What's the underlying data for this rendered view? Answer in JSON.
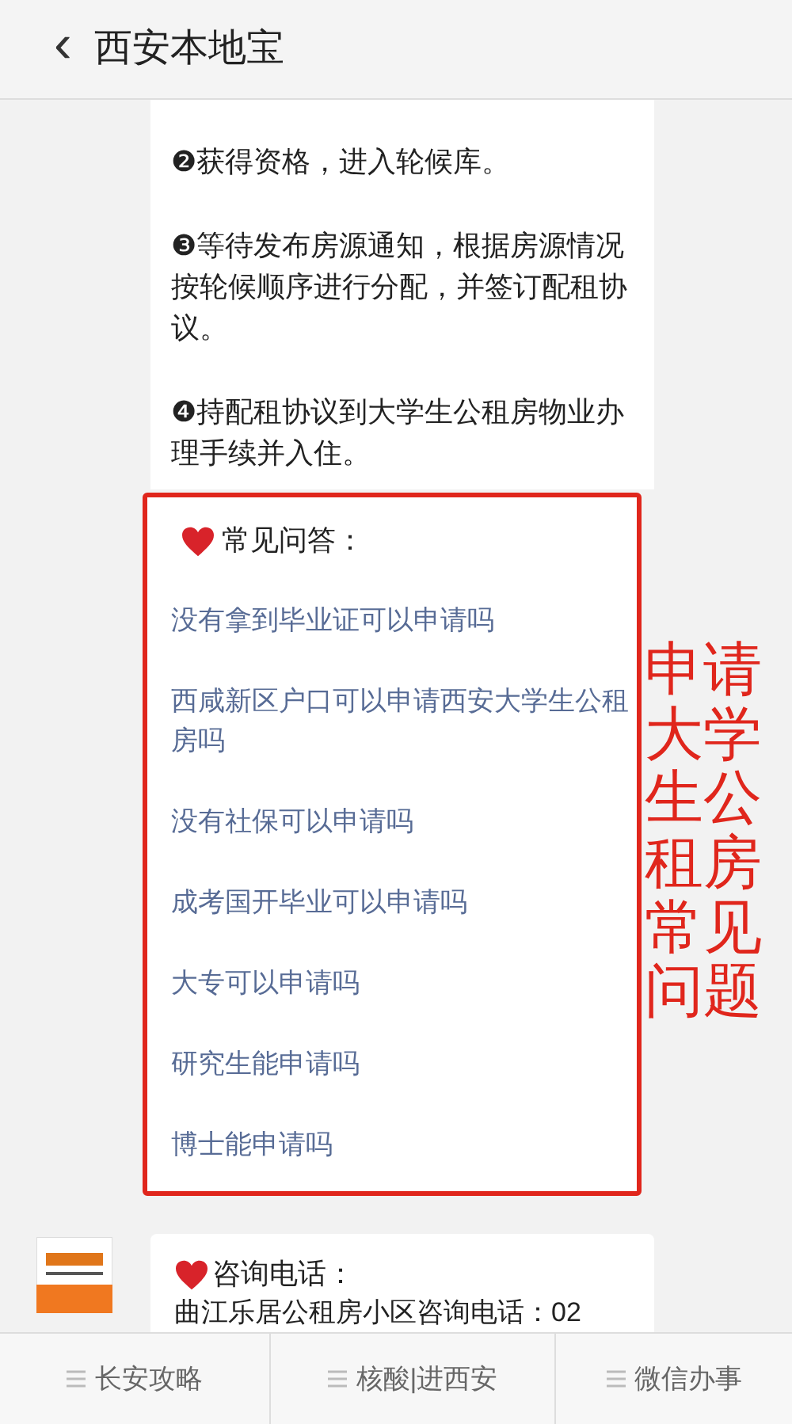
{
  "header": {
    "back": "‹",
    "title": "西安本地宝"
  },
  "steps": [
    "❷获得资格，进入轮候库。",
    "❸等待发布房源通知，根据房源情况按轮候顺序进行分配，并签订配租协议。",
    "❹持配租协议到大学生公租房物业办理手续并入住。"
  ],
  "faq": {
    "heading": "常见问答：",
    "links": [
      "没有拿到毕业证可以申请吗",
      "西咸新区户口可以申请西安大学生公租房吗",
      "没有社保可以申请吗",
      "成考国开毕业可以申请吗",
      "大专可以申请吗",
      "研究生能申请吗",
      "博士能申请吗"
    ]
  },
  "annotation": "申请大学生公租房常见问题",
  "contact": {
    "heading": "咨询电话：",
    "line": "曲江乐居公租房小区咨询电话：02"
  },
  "bottom_tabs": [
    "长安攻略",
    "核酸|进西安",
    "微信办事"
  ]
}
